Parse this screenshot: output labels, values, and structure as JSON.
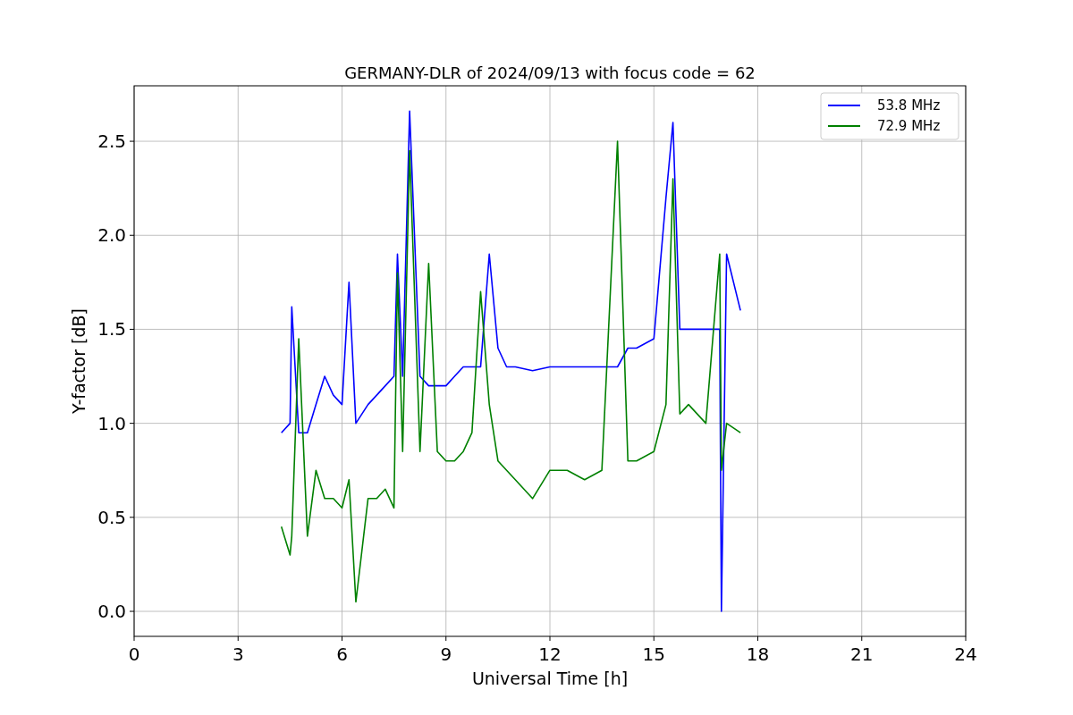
{
  "chart": {
    "chart_data": {
      "type": "line",
      "title": "GERMANY-DLR of 2024/09/13 with focus code = 62",
      "xlabel": "Universal Time [h]",
      "ylabel": "Y-factor [dB]",
      "x": [
        4.25,
        4.5,
        4.55,
        4.75,
        5,
        5.25,
        5.5,
        5.75,
        6,
        6.2,
        6.4,
        6.75,
        7,
        7.25,
        7.5,
        7.6,
        7.75,
        7.95,
        8.25,
        8.5,
        8.75,
        9,
        9.25,
        9.5,
        9.75,
        10,
        10.25,
        10.5,
        10.75,
        11,
        11.5,
        12,
        12.5,
        13,
        13.5,
        13.95,
        14.25,
        14.5,
        15,
        15.35,
        15.55,
        15.75,
        16,
        16.5,
        16.9,
        16.95,
        17.1,
        17.5
      ],
      "series": [
        {
          "name": "53.8 MHz",
          "color": "#0000ff",
          "values": [
            0.95,
            1.0,
            1.62,
            0.95,
            0.95,
            1.1,
            1.25,
            1.15,
            1.1,
            1.75,
            1.0,
            1.1,
            1.15,
            1.2,
            1.25,
            1.9,
            1.25,
            2.66,
            1.25,
            1.2,
            1.2,
            1.2,
            1.25,
            1.3,
            1.3,
            1.3,
            1.9,
            1.4,
            1.3,
            1.3,
            1.28,
            1.3,
            1.3,
            1.3,
            1.3,
            1.3,
            1.4,
            1.4,
            1.45,
            2.2,
            2.6,
            1.5,
            1.5,
            1.5,
            1.5,
            0.0,
            1.9,
            1.6
          ]
        },
        {
          "name": "72.9 MHz",
          "color": "#008000",
          "values": [
            0.45,
            0.3,
            0.4,
            1.45,
            0.4,
            0.75,
            0.6,
            0.6,
            0.55,
            0.7,
            0.05,
            0.6,
            0.6,
            0.65,
            0.55,
            1.8,
            0.85,
            2.45,
            0.85,
            1.85,
            0.85,
            0.8,
            0.8,
            0.85,
            0.95,
            1.7,
            1.1,
            0.8,
            0.75,
            0.7,
            0.6,
            0.75,
            0.75,
            0.7,
            0.75,
            2.5,
            0.8,
            0.8,
            0.85,
            1.1,
            2.3,
            1.05,
            1.1,
            1.0,
            1.9,
            0.75,
            1.0,
            0.95
          ]
        }
      ],
      "grid": true,
      "legend": true,
      "xlim": [
        0,
        24
      ],
      "ylim": [
        -0.133,
        2.795
      ],
      "xticks": [
        0,
        3,
        6,
        9,
        12,
        15,
        18,
        21,
        24
      ],
      "yticks": [
        {
          "value": 0,
          "label": "0.0"
        },
        {
          "value": 0.5,
          "label": "0.5"
        },
        {
          "value": 1,
          "label": "1.0"
        },
        {
          "value": 1.5,
          "label": "1.5"
        },
        {
          "value": 2,
          "label": "2.0"
        },
        {
          "value": 2.5,
          "label": "2.5"
        }
      ]
    }
  }
}
